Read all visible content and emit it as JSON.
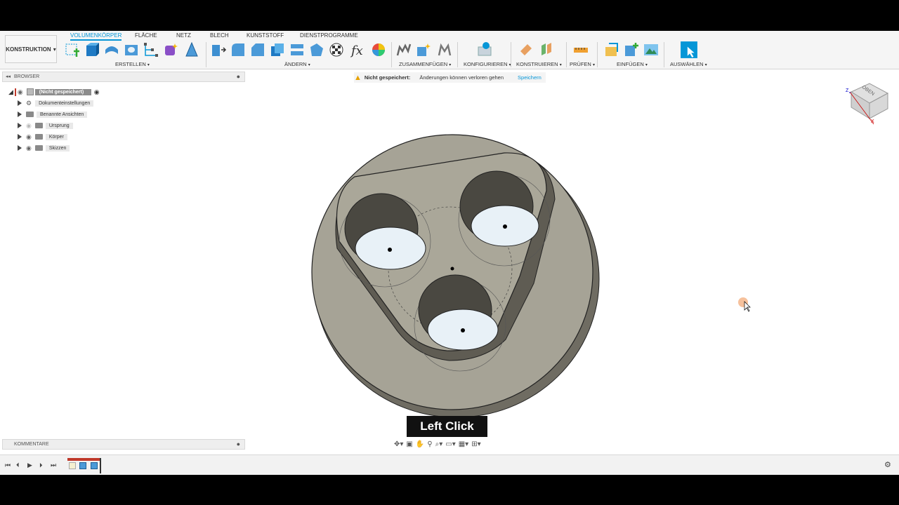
{
  "workspace": {
    "label": "KONSTRUKTION",
    "caret": "▾"
  },
  "tabs": [
    "VOLUMENKÖRPER",
    "FLÄCHE",
    "NETZ",
    "BLECH",
    "KUNSTSTOFF",
    "DIENSTPROGRAMME"
  ],
  "groups": {
    "erstellen": "ERSTELLEN",
    "aendern": "ÄNDERN",
    "zusammenfuegen": "ZUSAMMENFÜGEN",
    "konfigurieren": "KONFIGURIEREN",
    "konstruieren": "KONSTRUIEREN",
    "pruefen": "PRÜFEN",
    "einfuegen": "EINFÜGEN",
    "auswaehlen": "AUSWÄHLEN"
  },
  "browser": {
    "title": "BROWSER",
    "root": "(Nicht gespeichert)",
    "items": [
      "Dokumenteinstellungen",
      "Benannte Ansichten",
      "Ursprung",
      "Körper",
      "Skizzen"
    ]
  },
  "save_bar": {
    "warning": "Nicht gespeichert:",
    "message": "Änderungen können verloren gehen",
    "action": "Speichern"
  },
  "viewcube": {
    "face": "OBEN",
    "axis_z": "Z",
    "axis_x": "X"
  },
  "overlay": {
    "left_click": "Left Click"
  },
  "comments": {
    "title": "KOMMENTARE"
  },
  "colors": {
    "accent": "#0696d7",
    "part": "#a8a598",
    "part_dark": "#6f6c62",
    "hole": "#e8f1f7"
  }
}
